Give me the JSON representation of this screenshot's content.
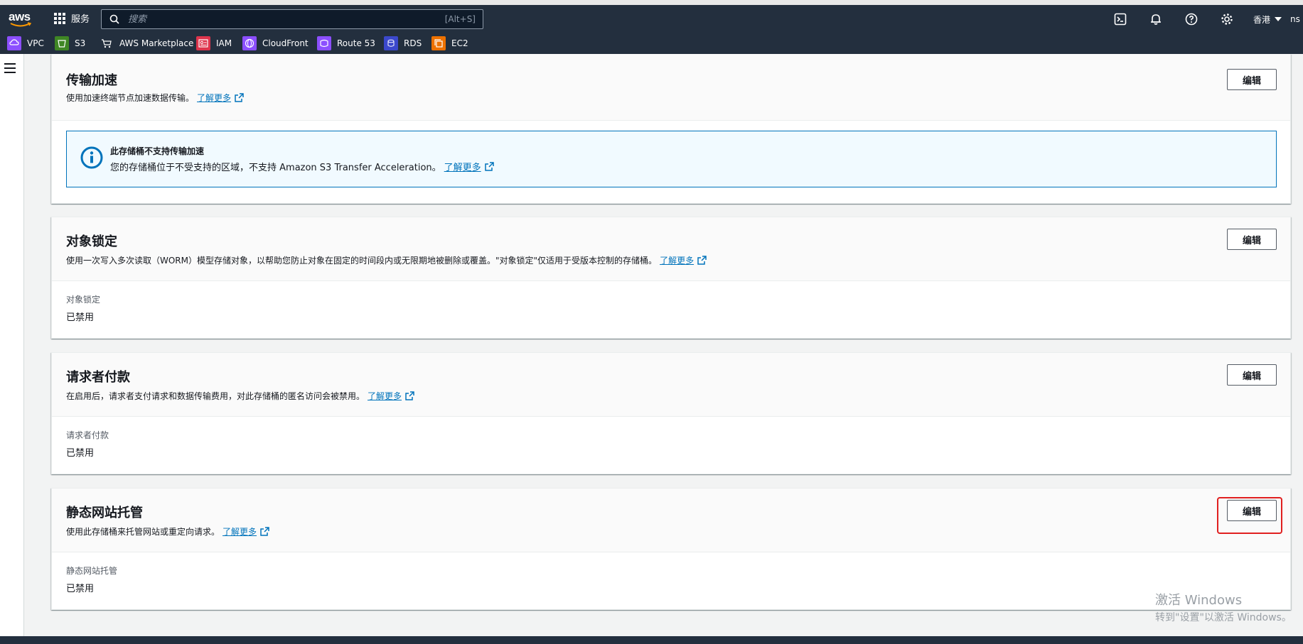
{
  "header": {
    "logo_text": "aws",
    "services_label": "服务",
    "search": {
      "placeholder": "搜索",
      "shortcut": "[Alt+S]"
    },
    "region": "香港",
    "account_fragment": "ns"
  },
  "favorites": [
    {
      "label": "VPC",
      "icon": "vpc-icon",
      "color": "#8c4fff"
    },
    {
      "label": "S3",
      "icon": "s3-bucket-icon",
      "color": "#3f8624"
    },
    {
      "label": "AWS Marketplace",
      "icon": "cart-icon",
      "color": "#232f3e"
    },
    {
      "label": "IAM",
      "icon": "iam-id-card-icon",
      "color": "#dd344c"
    },
    {
      "label": "CloudFront",
      "icon": "cloudfront-icon",
      "color": "#8c4fff"
    },
    {
      "label": "Route 53",
      "icon": "route53-icon",
      "color": "#8c4fff"
    },
    {
      "label": "RDS",
      "icon": "rds-icon",
      "color": "#3b48cc"
    },
    {
      "label": "EC2",
      "icon": "ec2-icon",
      "color": "#ed7100"
    }
  ],
  "panels": {
    "transfer": {
      "title": "传输加速",
      "desc": "使用加速终端节点加速数据传输。",
      "learn_more": "了解更多",
      "edit": "编辑",
      "alert": {
        "title": "此存储桶不支持传输加速",
        "text": "您的存储桶位于不受支持的区域，不支持 Amazon S3 Transfer Acceleration。",
        "learn_more": "了解更多"
      }
    },
    "object_lock": {
      "title": "对象锁定",
      "desc": "使用一次写入多次读取（WORM）模型存储对象，以帮助您防止对象在固定的时间段内或无限期地被删除或覆盖。\"对象锁定\"仅适用于受版本控制的存储桶。",
      "learn_more": "了解更多",
      "edit": "编辑",
      "field_label": "对象锁定",
      "field_value": "已禁用"
    },
    "requester_pays": {
      "title": "请求者付款",
      "desc": "在启用后，请求者支付请求和数据传输费用，对此存储桶的匿名访问会被禁用。",
      "learn_more": "了解更多",
      "edit": "编辑",
      "field_label": "请求者付款",
      "field_value": "已禁用"
    },
    "static_website": {
      "title": "静态网站托管",
      "desc": "使用此存储桶来托管网站或重定向请求。",
      "learn_more": "了解更多",
      "edit": "编辑",
      "field_label": "静态网站托管",
      "field_value": "已禁用"
    }
  },
  "watermark": {
    "line1": "激活 Windows",
    "line2": "转到\"设置\"以激活 Windows。"
  },
  "colors": {
    "nav_bg": "#232f3e",
    "link": "#0073bb",
    "highlight": "#e02020",
    "info_bg": "#f1faff"
  }
}
